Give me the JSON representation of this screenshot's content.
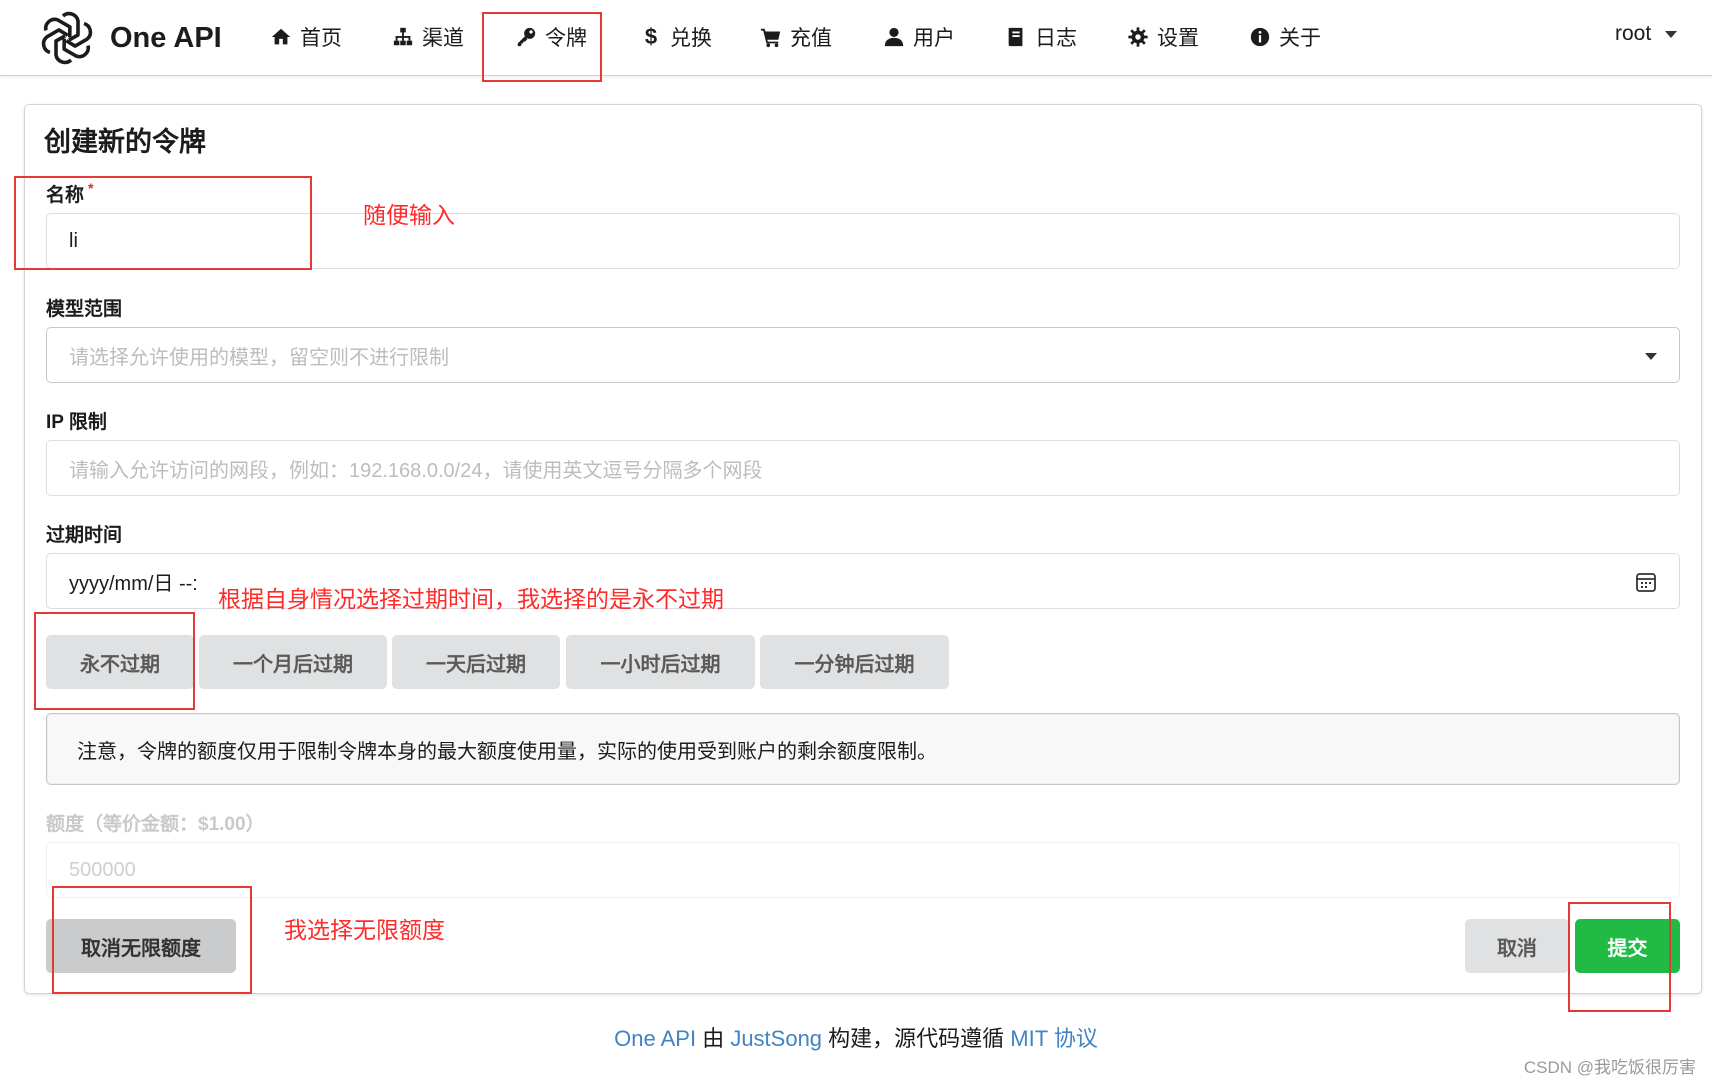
{
  "nav": {
    "brand": "One API",
    "items": [
      {
        "id": "home",
        "label": "首页",
        "icon": "home-icon"
      },
      {
        "id": "channel",
        "label": "渠道",
        "icon": "sitemap-icon"
      },
      {
        "id": "token",
        "label": "令牌",
        "icon": "key-icon"
      },
      {
        "id": "redeem",
        "label": "兑换",
        "icon": "dollar-icon"
      },
      {
        "id": "topup",
        "label": "充值",
        "icon": "cart-icon"
      },
      {
        "id": "user",
        "label": "用户",
        "icon": "user-icon"
      },
      {
        "id": "log",
        "label": "日志",
        "icon": "book-icon"
      },
      {
        "id": "setting",
        "label": "设置",
        "icon": "gear-icon"
      },
      {
        "id": "about",
        "label": "关于",
        "icon": "info-icon"
      }
    ],
    "user": "root"
  },
  "form": {
    "title": "创建新的令牌",
    "name_label": "名称",
    "required_mark": "*",
    "name_value": "li",
    "models_label": "模型范围",
    "models_placeholder": "请选择允许使用的模型，留空则不进行限制",
    "ip_label": "IP 限制",
    "ip_placeholder": "请输入允许访问的网段，例如：192.168.0.0/24，请使用英文逗号分隔多个网段",
    "expire_label": "过期时间",
    "expire_value": "yyyy/mm/日 --:",
    "expire_buttons": [
      "永不过期",
      "一个月后过期",
      "一天后过期",
      "一小时后过期",
      "一分钟后过期"
    ],
    "notice": "注意，令牌的额度仅用于限制令牌本身的最大额度使用量，实际的使用受到账户的剩余额度限制。",
    "quota_label": "额度（等价金额：$1.00）",
    "quota_value": "500000",
    "unlimited_button": "取消无限额度",
    "cancel_button": "取消",
    "submit_button": "提交"
  },
  "annotations": {
    "name_hint": "随便输入",
    "expire_hint": "根据自身情况选择过期时间，我选择的是永不过期",
    "quota_hint": "我选择无限额度"
  },
  "footer": {
    "project": "One API",
    "by": " 由 ",
    "author": "JustSong",
    "built": " 构建，源代码遵循 ",
    "license": "MIT 协议"
  },
  "watermark": "CSDN @我吃饭很厉害",
  "colors": {
    "submit": "#21ba45",
    "link": "#4183c4",
    "annotation": "#ff2a2a"
  }
}
